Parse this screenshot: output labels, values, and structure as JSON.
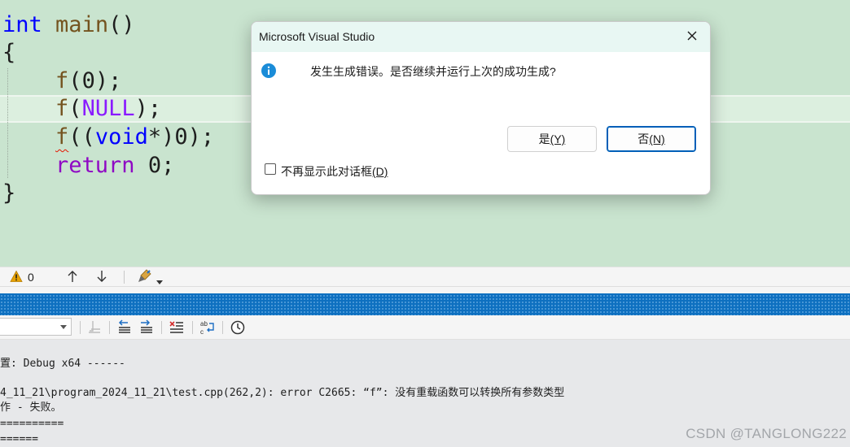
{
  "editor": {
    "line1": {
      "kw": "int",
      "fn": "main",
      "rest": "()"
    },
    "line2": "{",
    "line3": {
      "fn": "f",
      "a": "(",
      "arg": "0",
      "b": ");"
    },
    "line4": {
      "fn": "f",
      "a": "(",
      "macro": "NULL",
      "b": ");"
    },
    "line5": {
      "fn": "f",
      "a": "((",
      "kw": "void",
      "b": "*)0);"
    },
    "line6": {
      "kw": "return",
      "rest": " 0;"
    },
    "line7": "}"
  },
  "error_toolbar": {
    "warning_count": "0"
  },
  "output": {
    "lines": [
      "置: Debug x64 ------",
      "",
      "4_11_21\\program_2024_11_21\\test.cpp(262,2): error C2665: “f”: 没有重载函数可以转换所有参数类型",
      "作 - 失败。",
      "==========",
      "======"
    ],
    "watermark": "CSDN @TANGLONG222"
  },
  "dialog": {
    "title": "Microsoft Visual Studio",
    "message": "发生生成错误。是否继续并运行上次的成功生成?",
    "yes_label": "是",
    "yes_key": "(Y)",
    "no_label": "否",
    "no_key": "(N)",
    "checkbox_label": "不再显示此对话框",
    "checkbox_key": "(D)"
  },
  "colors": {
    "editor_bg": "#c9e4cf",
    "accent_blue": "#0e70c0",
    "info_icon": "#1a8cd8"
  }
}
